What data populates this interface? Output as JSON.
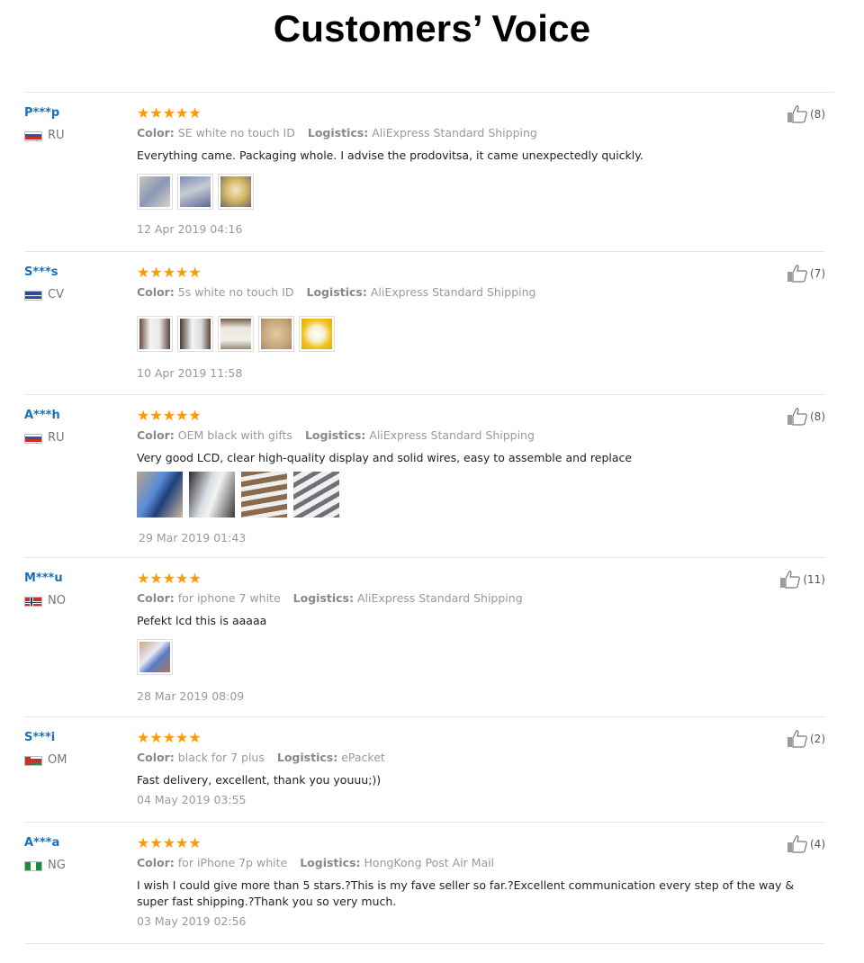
{
  "title": "Customers’ Voice",
  "labels": {
    "color": "Color:",
    "logistics": "Logistics:"
  },
  "colors": {
    "username": "#1a6fb8",
    "star": "#ff9a00",
    "meta": "#999999"
  },
  "reviews": [
    {
      "user": "P***p",
      "country": "RU",
      "stars": "★★★★★",
      "rating": 5,
      "color": "SE white no touch ID",
      "logistics": "AliExpress Standard Shipping",
      "text": "Everything came. Packaging whole. I advise the prodovitsa, it came unexpectedly quickly.",
      "date": "12 Apr 2019 04:16",
      "likes": "(8)"
    },
    {
      "user": "S***s",
      "country": "CV",
      "stars": "★★★★★",
      "rating": 5,
      "color": "5s white no touch ID",
      "logistics": "AliExpress Standard Shipping",
      "text": "",
      "date": "10 Apr 2019 11:58",
      "likes": "(7)"
    },
    {
      "user": "A***h",
      "country": "RU",
      "stars": "★★★★★",
      "rating": 5,
      "color": "OEM black with gifts",
      "logistics": "AliExpress Standard Shipping",
      "text": "Very good LCD, clear high-quality display and solid wires, easy to assemble and replace",
      "date": "29 Mar 2019 01:43",
      "likes": "(8)"
    },
    {
      "user": "M***u",
      "country": "NO",
      "stars": "★★★★★",
      "rating": 5,
      "color": "for iphone 7 white",
      "logistics": "AliExpress Standard Shipping",
      "text": "Pefekt lcd this is aaaaa",
      "date": "28 Mar 2019 08:09",
      "likes": "(11)"
    },
    {
      "user": "S***i",
      "country": "OM",
      "stars": "★★★★★",
      "rating": 5,
      "color": "black for 7 plus",
      "logistics": "ePacket",
      "text": "Fast delivery, excellent, thank you youuu;))",
      "date": "04 May 2019 03:55",
      "likes": "(2)"
    },
    {
      "user": "A***a",
      "country": "NG",
      "stars": "★★★★★",
      "rating": 5,
      "color": "for iPhone 7p white",
      "logistics": "HongKong Post Air Mail",
      "text": "I wish I could give more than 5 stars.?This is my fave seller so far.?Excellent communication every step of the way & super fast shipping.?Thank you so very much.",
      "date": "03 May 2019 02:56",
      "likes": "(4)"
    }
  ]
}
